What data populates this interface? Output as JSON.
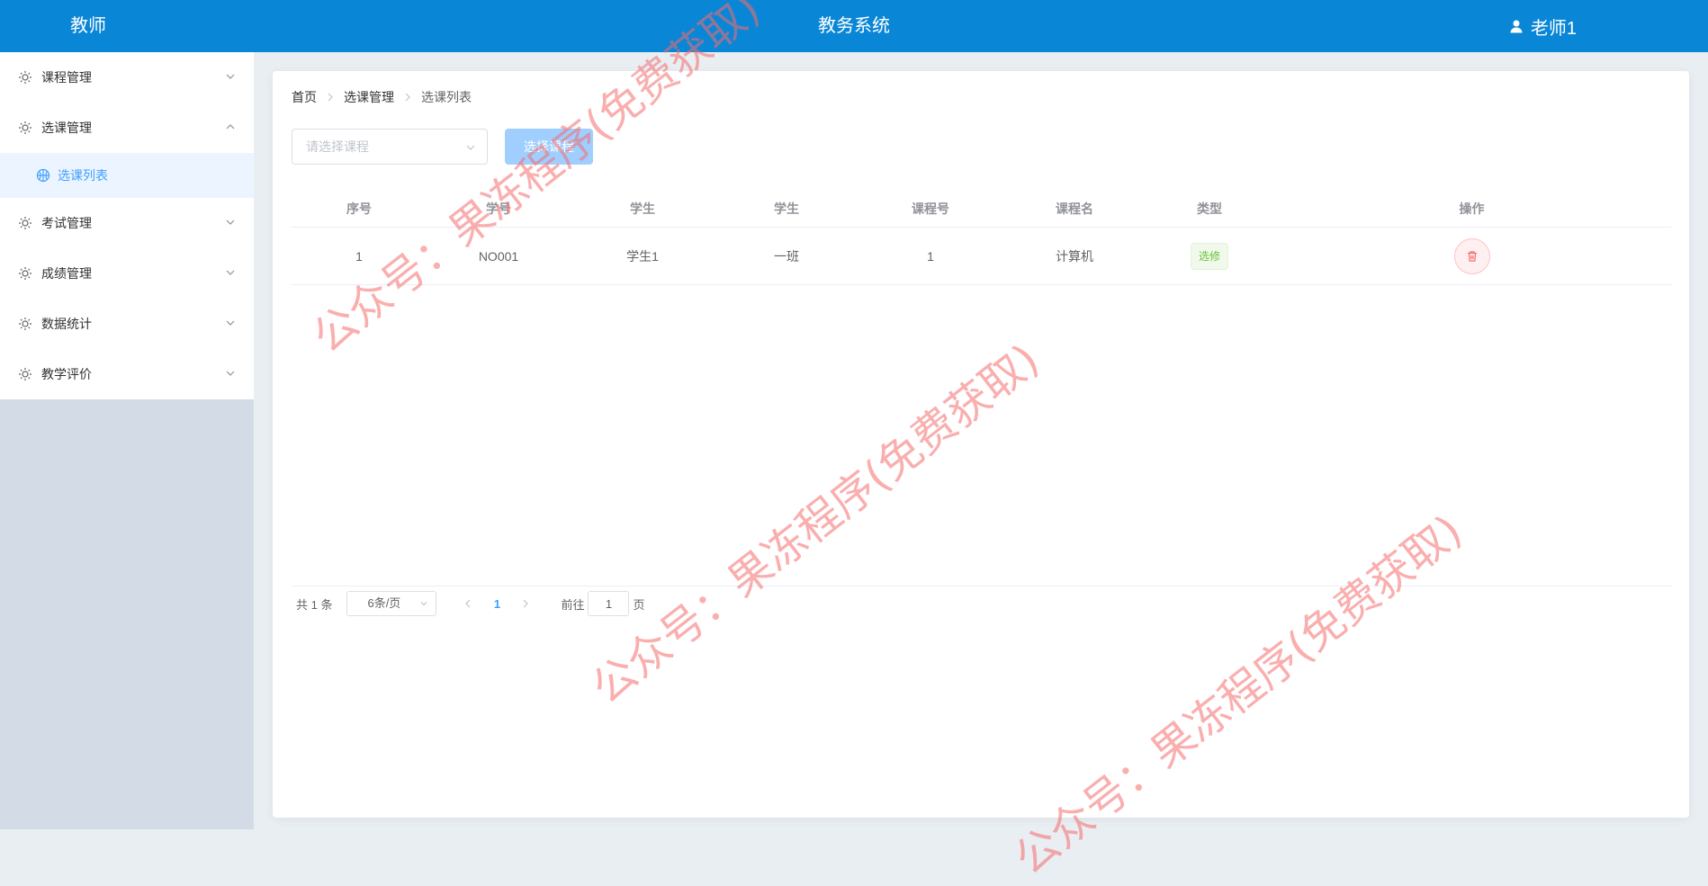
{
  "header": {
    "brand": "教师",
    "title": "教务系统",
    "user_name": "老师1"
  },
  "sidebar": {
    "items": [
      {
        "label": "课程管理"
      },
      {
        "label": "选课管理"
      },
      {
        "label": "考试管理"
      },
      {
        "label": "成绩管理"
      },
      {
        "label": "数据统计"
      },
      {
        "label": "教学评价"
      }
    ],
    "active_sub": "选课列表"
  },
  "breadcrumb": [
    "首页",
    "选课管理",
    "选课列表"
  ],
  "toolbar": {
    "select_placeholder": "请选择课程",
    "button_label": "选择课程"
  },
  "table": {
    "headers": [
      "序号",
      "学号",
      "学生",
      "学生",
      "课程号",
      "课程名",
      "类型",
      "操作"
    ],
    "rows": [
      {
        "index": "1",
        "student_no": "NO001",
        "student": "学生1",
        "class": "一班",
        "course_no": "1",
        "course_name": "计算机",
        "type": "选修"
      }
    ]
  },
  "pagination": {
    "total_text": "共 1 条",
    "page_size": "6条/页",
    "current_page": "1",
    "goto_label": "前往",
    "goto_value": "1",
    "page_suffix": "页"
  },
  "watermark": "公众号：果冻程序(免费获取)",
  "colors": {
    "header_bg": "#0a86d6",
    "primary": "#409eff",
    "success": "#67c23a",
    "danger": "#f56c6c"
  }
}
